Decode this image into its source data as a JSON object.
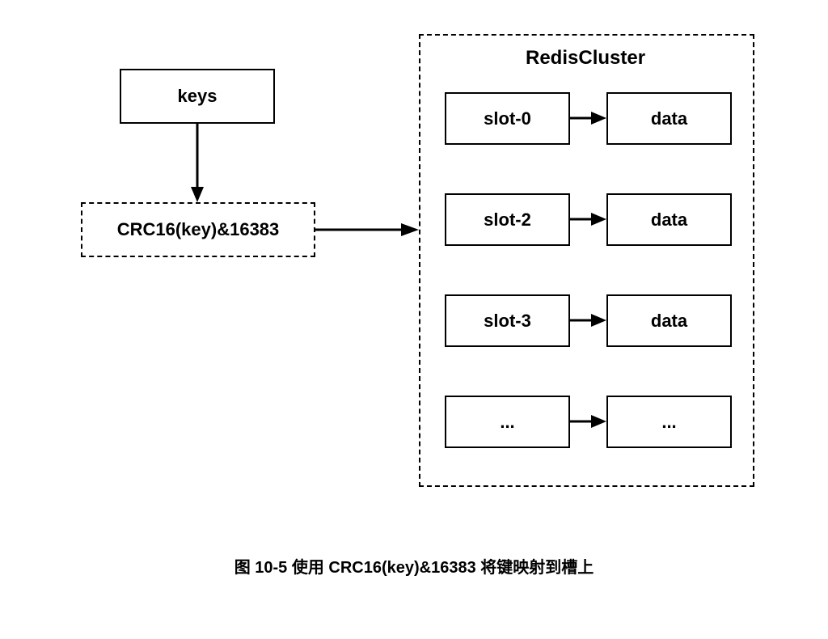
{
  "keys_box": "keys",
  "hash_box": "CRC16(key)&16383",
  "cluster_title": "RedisCluster",
  "rows": [
    {
      "slot": "slot-0",
      "data": "data"
    },
    {
      "slot": "slot-2",
      "data": "data"
    },
    {
      "slot": "slot-3",
      "data": "data"
    },
    {
      "slot": "...",
      "data": "..."
    }
  ],
  "caption": "图 10-5 使用 CRC16(key)&16383 将键映射到槽上"
}
